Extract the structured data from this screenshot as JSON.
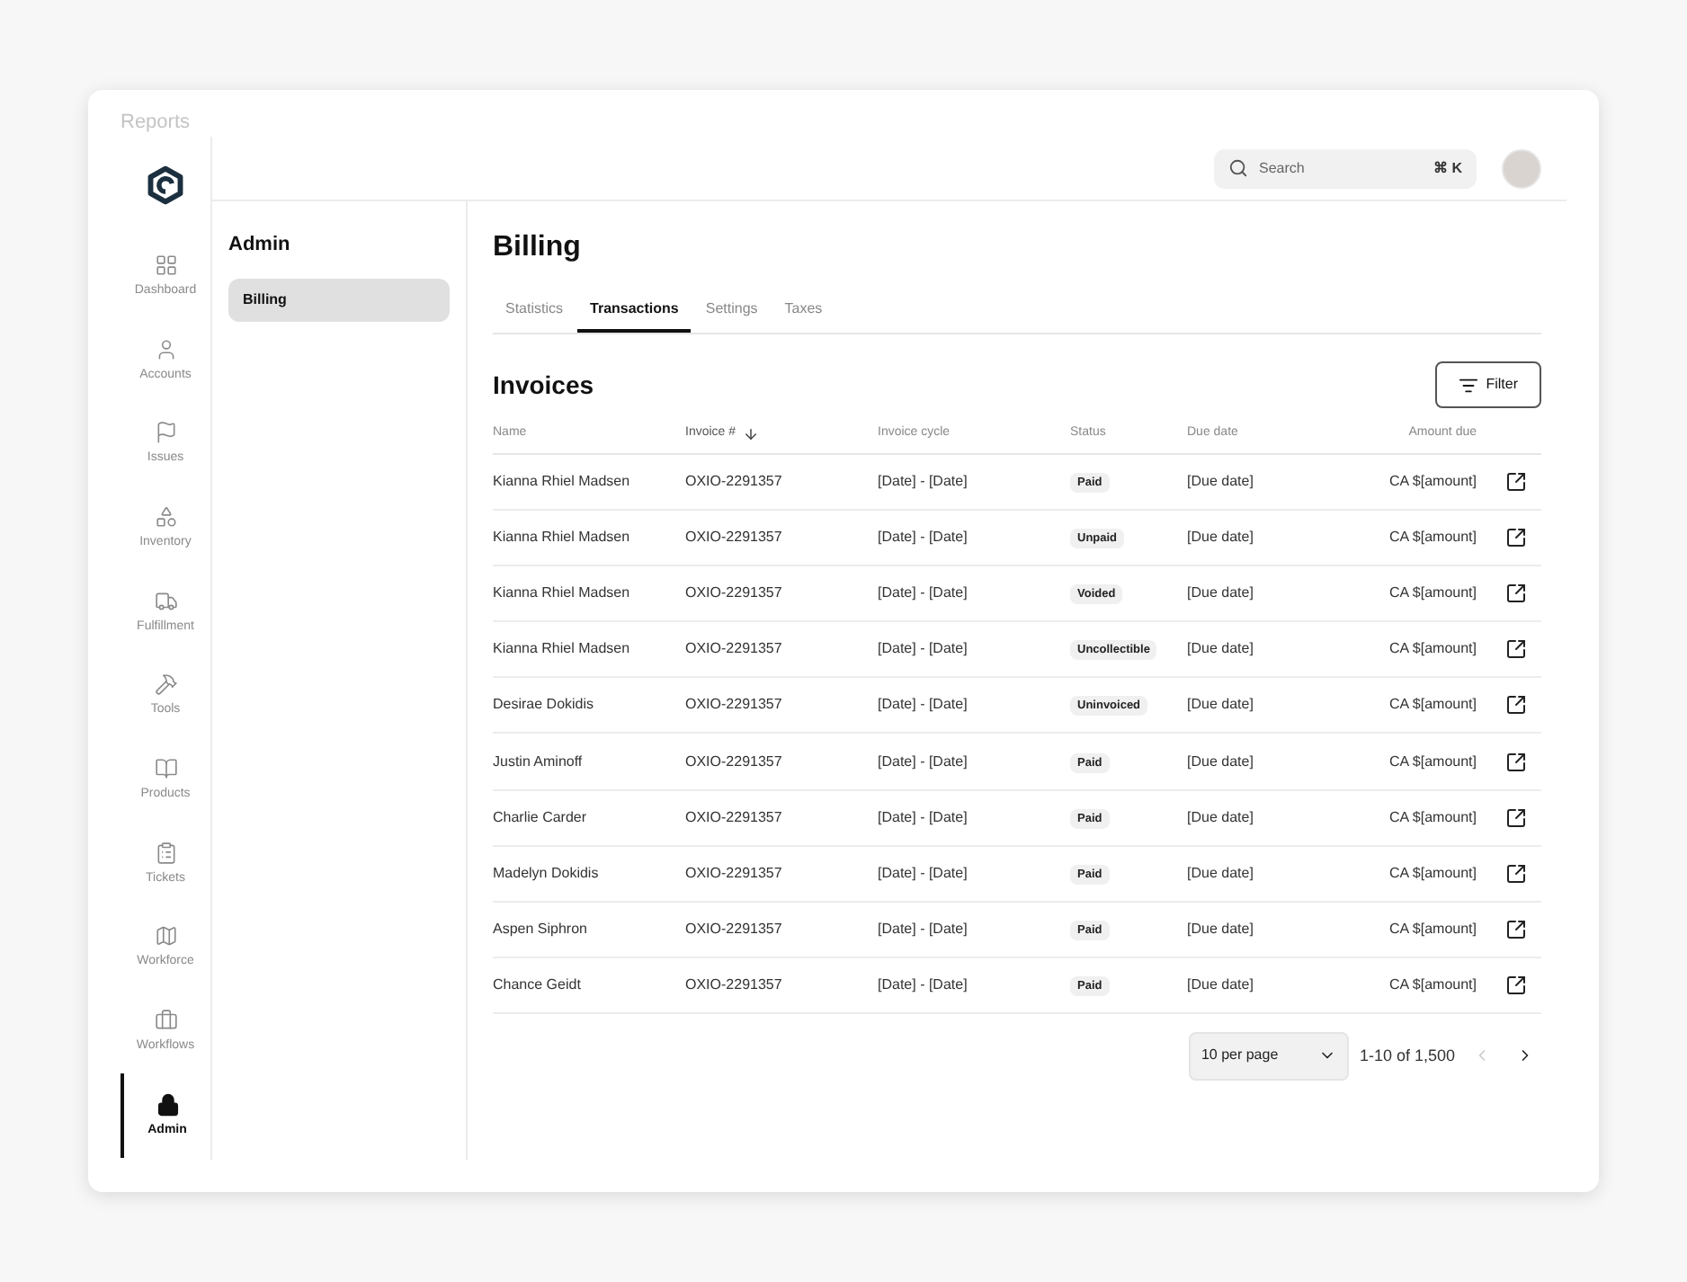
{
  "breadcrumb": "Reports",
  "nav": [
    {
      "label": "Dashboard",
      "selected": false
    },
    {
      "label": "Accounts",
      "selected": false
    },
    {
      "label": "Issues",
      "selected": false
    },
    {
      "label": "Inventory",
      "selected": false
    },
    {
      "label": "Fulfillment",
      "selected": false
    },
    {
      "label": "Tools",
      "selected": false
    },
    {
      "label": "Products",
      "selected": false
    },
    {
      "label": "Tickets",
      "selected": false
    },
    {
      "label": "Workforce",
      "selected": false
    },
    {
      "label": "Workflows",
      "selected": false
    },
    {
      "label": "Admin",
      "selected": true
    }
  ],
  "section": {
    "title": "Admin",
    "items": [
      {
        "label": "Billing",
        "selected": true
      }
    ]
  },
  "search": {
    "placeholder": "Search",
    "shortcut": "⌘ K"
  },
  "page_title": "Billing",
  "tabs": [
    {
      "label": "Statistics",
      "selected": false
    },
    {
      "label": "Transactions",
      "selected": true
    },
    {
      "label": "Settings",
      "selected": false
    },
    {
      "label": "Taxes",
      "selected": false
    }
  ],
  "invoices": {
    "title": "Invoices",
    "filter_button": "Filter",
    "columns": [
      {
        "label": "Name",
        "sorted": false
      },
      {
        "label": "Invoice #",
        "sorted": true
      },
      {
        "label": "Invoice cycle",
        "sorted": false
      },
      {
        "label": "Status",
        "sorted": false
      },
      {
        "label": "Due date",
        "sorted": false
      },
      {
        "label": "Amount due",
        "sorted": false
      }
    ],
    "rows": [
      {
        "name": "Kianna Rhiel Madsen",
        "invoice": "OXIO-2291357",
        "cycle": "[Date] - [Date]",
        "status": "Paid",
        "due": "[Due date]",
        "amount": "CA $[amount]"
      },
      {
        "name": "Kianna Rhiel Madsen",
        "invoice": "OXIO-2291357",
        "cycle": "[Date] - [Date]",
        "status": "Unpaid",
        "due": "[Due date]",
        "amount": "CA $[amount]"
      },
      {
        "name": "Kianna Rhiel Madsen",
        "invoice": "OXIO-2291357",
        "cycle": "[Date] - [Date]",
        "status": "Voided",
        "due": "[Due date]",
        "amount": "CA $[amount]"
      },
      {
        "name": "Kianna Rhiel Madsen",
        "invoice": "OXIO-2291357",
        "cycle": "[Date] - [Date]",
        "status": "Uncollectible",
        "due": "[Due date]",
        "amount": "CA $[amount]"
      },
      {
        "name": "Desirae Dokidis",
        "invoice": "OXIO-2291357",
        "cycle": "[Date] - [Date]",
        "status": "Uninvoiced",
        "due": "[Due date]",
        "amount": "CA $[amount]"
      },
      {
        "name": "Justin Aminoff",
        "invoice": "OXIO-2291357",
        "cycle": "[Date] - [Date]",
        "status": "Paid",
        "due": "[Due date]",
        "amount": "CA $[amount]"
      },
      {
        "name": "Charlie Carder",
        "invoice": "OXIO-2291357",
        "cycle": "[Date] - [Date]",
        "status": "Paid",
        "due": "[Due date]",
        "amount": "CA $[amount]"
      },
      {
        "name": "Madelyn Dokidis",
        "invoice": "OXIO-2291357",
        "cycle": "[Date] - [Date]",
        "status": "Paid",
        "due": "[Due date]",
        "amount": "CA $[amount]"
      },
      {
        "name": "Aspen Siphron",
        "invoice": "OXIO-2291357",
        "cycle": "[Date] - [Date]",
        "status": "Paid",
        "due": "[Due date]",
        "amount": "CA $[amount]"
      },
      {
        "name": "Chance Geidt",
        "invoice": "OXIO-2291357",
        "cycle": "[Date] - [Date]",
        "status": "Paid",
        "due": "[Due date]",
        "amount": "CA $[amount]"
      }
    ],
    "pagination": {
      "per_page": "10 per page",
      "range": "1-10 of 1,500",
      "prev_disabled": true,
      "next_disabled": false
    }
  }
}
